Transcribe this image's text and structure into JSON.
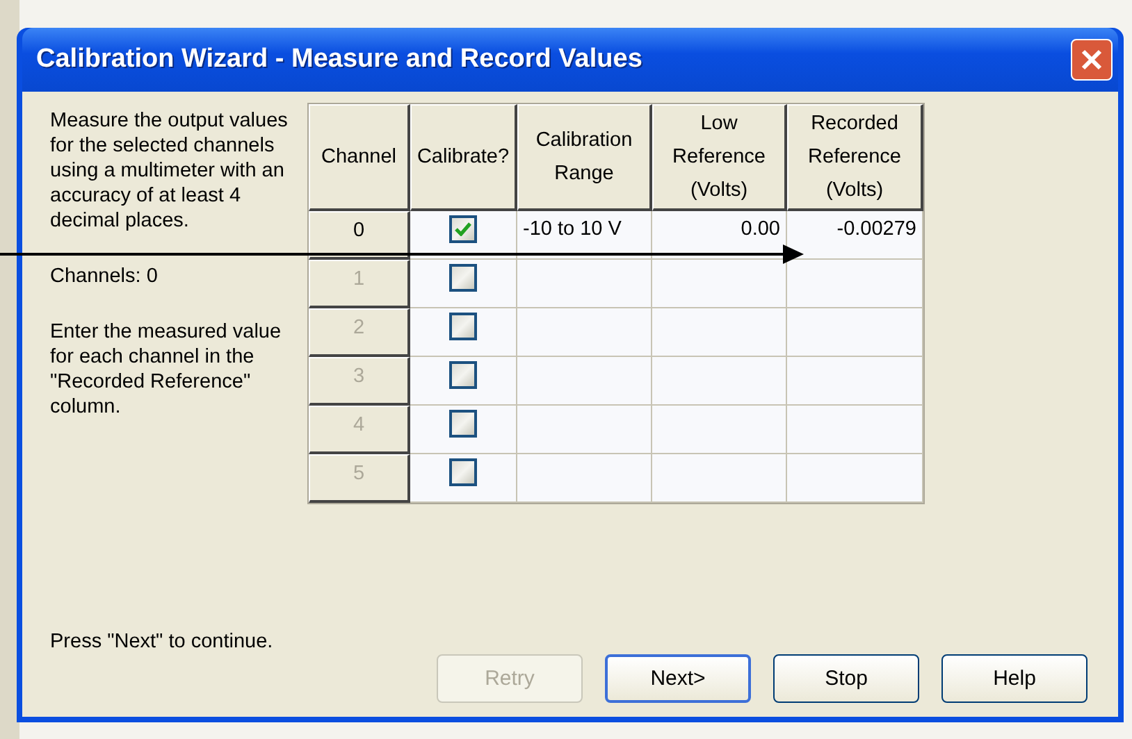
{
  "dialog": {
    "title": "Calibration Wizard - Measure and Record Values"
  },
  "instructions": [
    {
      "kind": "text",
      "text": "Measure the output values for the selected channels using a multimeter with an accuracy of at least 4 decimal  places."
    },
    {
      "kind": "text",
      "text": "Channels: 0"
    },
    {
      "kind": "text",
      "text": "Enter the measured value for each channel in the \"Recorded Reference\" column."
    },
    {
      "kind": "footer",
      "text": "Press \"Next\" to continue."
    }
  ],
  "table": {
    "columns": [
      "Channel",
      "Calibrate?",
      "Calibration Range",
      "Low Reference (Volts)",
      "Recorded Reference (Volts)"
    ],
    "rows": [
      {
        "channel": "0",
        "enabled": true,
        "checked": true,
        "range": "-10 to 10 V",
        "low": "0.00",
        "recorded": "-0.00279"
      },
      {
        "channel": "1",
        "enabled": false,
        "checked": false
      },
      {
        "channel": "2",
        "enabled": false,
        "checked": false
      },
      {
        "channel": "3",
        "enabled": false,
        "checked": false
      },
      {
        "channel": "4",
        "enabled": false,
        "checked": false
      },
      {
        "channel": "5",
        "enabled": false,
        "checked": false
      }
    ]
  },
  "buttons": [
    {
      "label": "Retry",
      "disabled": true,
      "default": false
    },
    {
      "label": "Next>",
      "disabled": false,
      "default": true
    },
    {
      "label": "Stop",
      "disabled": false,
      "default": false
    },
    {
      "label": "Help",
      "disabled": false,
      "default": false
    }
  ]
}
